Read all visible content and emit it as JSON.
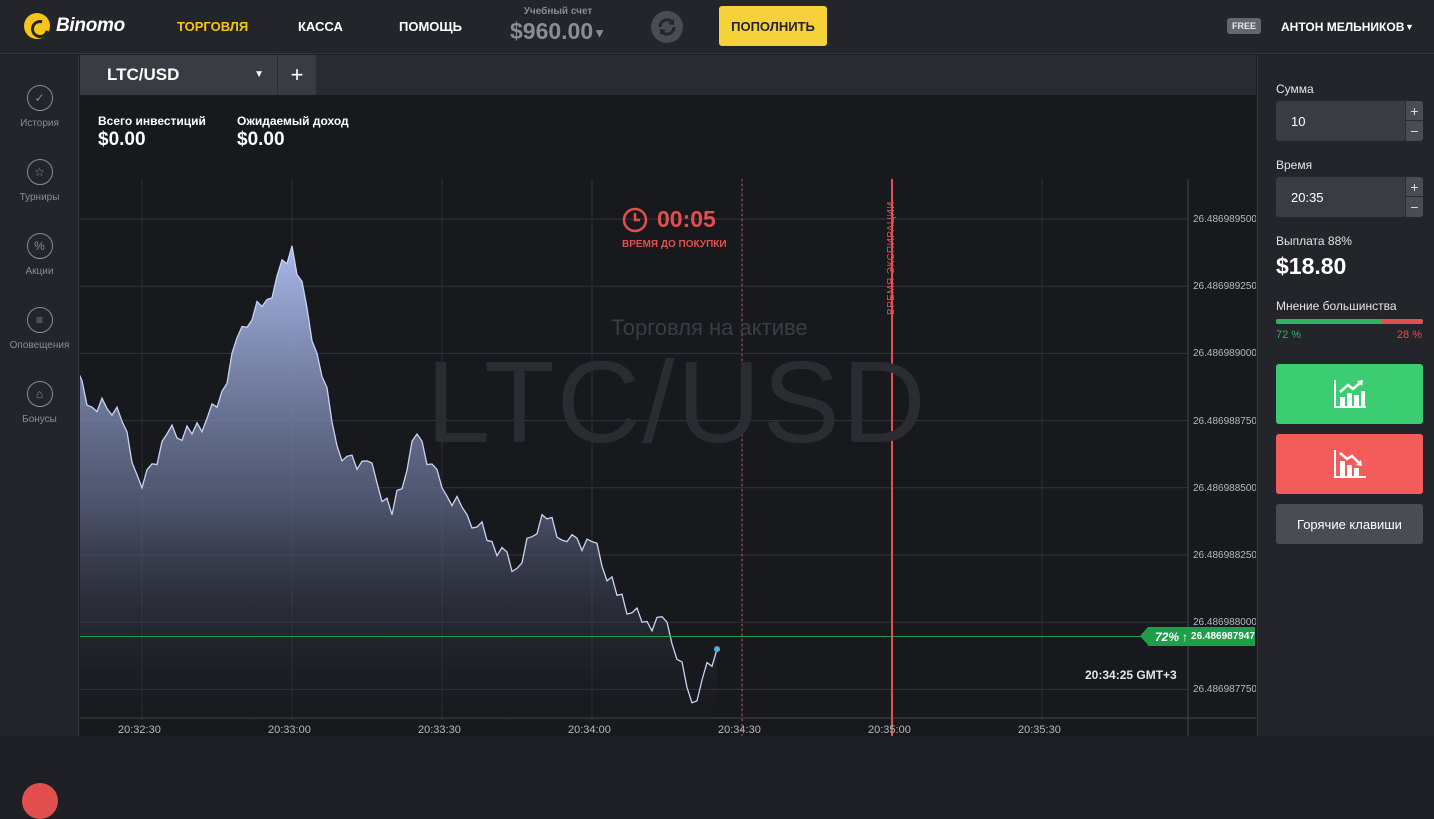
{
  "header": {
    "logo_text": "Binomo",
    "nav": [
      {
        "label": "ТОРГОВЛЯ",
        "active": true
      },
      {
        "label": "КАССА",
        "active": false
      },
      {
        "label": "ПОМОЩЬ",
        "active": false
      }
    ],
    "account_label": "Учебный счет",
    "account_balance": "$960.00",
    "deposit_label": "ПОПОЛНИТЬ",
    "free_badge": "FREE",
    "username": "АНТОН МЕЛЬНИКОВ",
    "accent_color": "#f5c518"
  },
  "sidebar": {
    "items": [
      {
        "label": "История",
        "icon": "check-circle-icon"
      },
      {
        "label": "Турниры",
        "icon": "trophy-icon"
      },
      {
        "label": "Акции",
        "icon": "percent-icon"
      },
      {
        "label": "Оповещения",
        "icon": "list-icon"
      },
      {
        "label": "Бонусы",
        "icon": "gift-icon"
      }
    ]
  },
  "tabs": {
    "active_asset": "LTC/USD",
    "add_label": "+"
  },
  "chart": {
    "total_investments_label": "Всего инвестиций",
    "total_investments_value": "$0.00",
    "expected_income_label": "Ожидаемый доход",
    "expected_income_value": "$0.00",
    "timer_value": "00:05",
    "timer_label": "ВРЕМЯ ДО ПОКУПКИ",
    "watermark_sub": "Торговля на активе",
    "watermark": "LTC/USD",
    "expiry_label": "ВРЕМЯ ЭКСПИРАЦИИ",
    "current_time": "20:34:25 GMT+3",
    "price_tag_percent": "72%",
    "price_tag_arrow": "↑",
    "price_tag_value": "26.486987947",
    "price_ticks": [
      "26.486989500",
      "26.486989250",
      "26.486989000",
      "26.486988750",
      "26.486988500",
      "26.486988250",
      "26.486988000",
      "26.486987750"
    ],
    "time_ticks": [
      "20:32:30",
      "20:33:00",
      "20:33:30",
      "20:34:00",
      "20:34:30",
      "20:35:00",
      "20:35:30"
    ],
    "line_color": "#aab8e6",
    "expiry_color": "#e34e4e",
    "current_price_color": "#1f9d48"
  },
  "chart_data": {
    "type": "area",
    "title": "",
    "xlabel": "",
    "ylabel": "",
    "x_range": [
      "20:32:15",
      "20:35:45"
    ],
    "ylim": [
      26.4869877,
      26.48699
    ],
    "x": [
      "20:32:15",
      "20:32:20",
      "20:32:25",
      "20:32:30",
      "20:32:35",
      "20:32:40",
      "20:32:45",
      "20:32:50",
      "20:32:55",
      "20:33:00",
      "20:33:05",
      "20:33:10",
      "20:33:15",
      "20:33:20",
      "20:33:25",
      "20:33:30",
      "20:33:35",
      "20:33:40",
      "20:33:45",
      "20:33:50",
      "20:33:55",
      "20:34:00",
      "20:34:05",
      "20:34:10",
      "20:34:15",
      "20:34:20",
      "20:34:25"
    ],
    "values": [
      26.486989,
      26.4869888,
      26.4869888,
      26.4869885,
      26.4869887,
      26.4869887,
      26.4869888,
      26.4869891,
      26.4869892,
      26.4869894,
      26.486989,
      26.4869886,
      26.4869886,
      26.4869884,
      26.4869887,
      26.4869885,
      26.4869884,
      26.4869883,
      26.4869882,
      26.4869884,
      26.4869883,
      26.4869883,
      26.4869881,
      26.486988,
      26.486988,
      26.4869877,
      26.4869879
    ],
    "current_price": 26.486987947,
    "expiry_time": "20:35:00",
    "purchase_deadline": "20:34:30",
    "grid": true
  },
  "panel": {
    "amount_label": "Сумма",
    "amount_value": "10",
    "time_label": "Время",
    "time_value": "20:35",
    "plus": "+",
    "minus": "−",
    "payout_label": "Выплата 88%",
    "payout_value": "$18.80",
    "sentiment_label": "Мнение большинства",
    "sentiment_up": 72,
    "sentiment_down": 28,
    "sentiment_up_text": "72 %",
    "sentiment_down_text": "28 %",
    "up_color": "#3ccd72",
    "down_color": "#f45b5b",
    "hotkeys_label": "Горячие клавиши"
  }
}
